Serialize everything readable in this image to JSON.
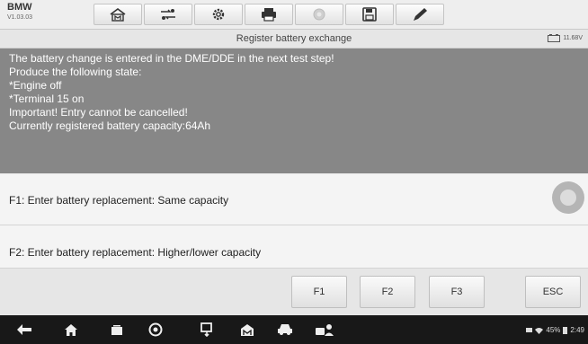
{
  "app": {
    "brand": "BMW",
    "version": "V1.03.03"
  },
  "toolbar": {
    "buttons": [
      {
        "icon": "home-icon"
      },
      {
        "icon": "vehicle-swap-icon"
      },
      {
        "icon": "gear-icon"
      },
      {
        "icon": "printer-icon"
      },
      {
        "icon": "help-icon"
      },
      {
        "icon": "save-icon"
      },
      {
        "icon": "pen-icon"
      }
    ]
  },
  "titlebar": {
    "title": "Register battery exchange",
    "battery_voltage": "11.68V"
  },
  "message": {
    "lines": [
      "The battery change is entered in the DME/DDE in the next test step!",
      "Produce the following state:",
      "*Engine off",
      "*Terminal 15 on",
      "Important! Entry cannot be cancelled!",
      "Currently registered battery capacity:64Ah"
    ]
  },
  "options": [
    {
      "label": "F1: Enter battery replacement: Same capacity"
    },
    {
      "label": "F2: Enter battery replacement: Higher/lower capacity"
    }
  ],
  "function_buttons": {
    "f1": "F1",
    "f2": "F2",
    "f3": "F3",
    "esc": "ESC"
  },
  "statusbar": {
    "battery_percent": "45%",
    "time": "2:49"
  },
  "colors": {
    "message_bg": "#878787",
    "navbar_bg": "#181818"
  }
}
